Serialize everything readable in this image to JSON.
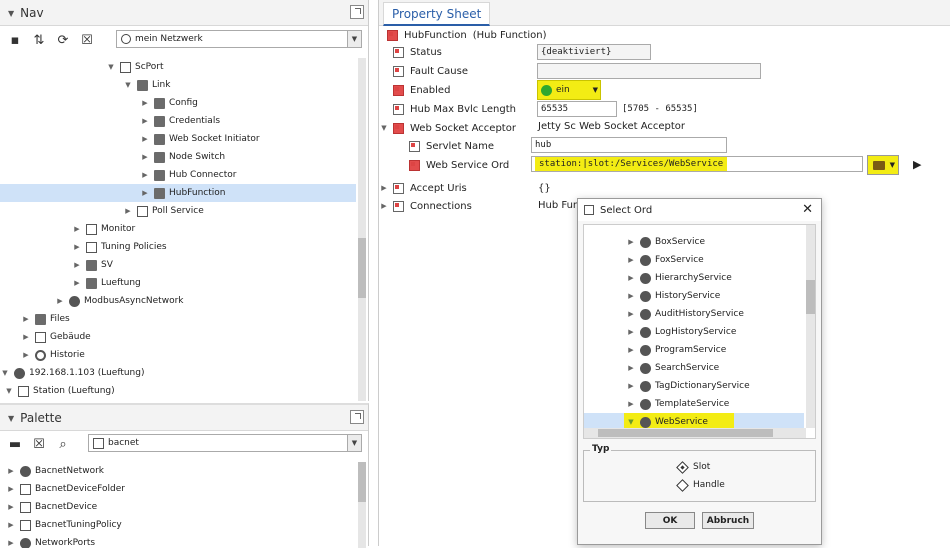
{
  "nav": {
    "title": "Nav",
    "ord_combo": "mein Netzwerk",
    "tree": [
      {
        "label": "ScPort",
        "icon": "port-icon",
        "depth": 8,
        "expanded": true
      },
      {
        "label": "Link",
        "icon": "folder-icon",
        "depth": 9,
        "expanded": true
      },
      {
        "label": "Config",
        "icon": "folder-icon",
        "depth": 10,
        "expanded": false
      },
      {
        "label": "Credentials",
        "icon": "folder-icon",
        "depth": 10,
        "expanded": false
      },
      {
        "label": "Web Socket Initiator",
        "icon": "folder-icon",
        "depth": 10,
        "expanded": false
      },
      {
        "label": "Node Switch",
        "icon": "folder-icon",
        "depth": 10,
        "expanded": false
      },
      {
        "label": "Hub Connector",
        "icon": "folder-icon",
        "depth": 10,
        "expanded": false
      },
      {
        "label": "HubFunction",
        "icon": "folder-icon",
        "depth": 10,
        "expanded": false,
        "selected": true
      },
      {
        "label": "Poll Service",
        "icon": "poll-icon",
        "depth": 9,
        "expanded": false
      },
      {
        "label": "Monitor",
        "icon": "monitor-icon",
        "depth": 6,
        "expanded": false
      },
      {
        "label": "Tuning Policies",
        "icon": "tuning-icon",
        "depth": 6,
        "expanded": false
      },
      {
        "label": "SV",
        "icon": "folder-icon",
        "depth": 6,
        "expanded": false
      },
      {
        "label": "Lueftung",
        "icon": "folder-icon",
        "depth": 6,
        "expanded": false
      },
      {
        "label": "ModbusAsyncNetwork",
        "icon": "network-icon",
        "depth": 5,
        "expanded": false
      },
      {
        "label": "Files",
        "icon": "folder-icon",
        "depth": 3,
        "expanded": false
      },
      {
        "label": "Gebäude",
        "icon": "building-icon",
        "depth": 3,
        "expanded": false
      },
      {
        "label": "Historie",
        "icon": "history-icon",
        "depth": 3,
        "expanded": false
      },
      {
        "label": "192.168.1.103 (Lueftung)",
        "icon": "host-icon",
        "depth": 1,
        "expanded": true
      },
      {
        "label": "Station (Lueftung)",
        "icon": "station-icon",
        "depth": 2,
        "expanded": true
      }
    ]
  },
  "palette": {
    "title": "Palette",
    "combo": "bacnet",
    "items": [
      {
        "label": "BacnetNetwork",
        "icon": "network-icon"
      },
      {
        "label": "BacnetDeviceFolder",
        "icon": "folder-icon"
      },
      {
        "label": "BacnetDevice",
        "icon": "device-icon"
      },
      {
        "label": "BacnetTuningPolicy",
        "icon": "tuning-icon"
      },
      {
        "label": "NetworkPorts",
        "icon": "network-icon"
      }
    ]
  },
  "property_sheet": {
    "tab": "Property Sheet",
    "header_name": "HubFunction",
    "header_type": "(Hub Function)",
    "rows": [
      {
        "label": "Status",
        "value": "{deaktiviert}"
      },
      {
        "label": "Fault Cause",
        "value": ""
      },
      {
        "label": "Enabled",
        "value": "ein"
      },
      {
        "label": "Hub Max Bvlc Length",
        "value": "65535",
        "range": "[5705 - 65535]"
      },
      {
        "label": "Web Socket Acceptor",
        "value": "Jetty Sc Web Socket Acceptor"
      },
      {
        "label": "Servlet Name",
        "value": "hub"
      },
      {
        "label": "Web Service Ord",
        "value": "station:|slot:/Services/WebService"
      },
      {
        "label": "Accept Uris",
        "value": "{}"
      },
      {
        "label": "Connections",
        "value": "Hub Fun"
      }
    ]
  },
  "dialog": {
    "title": "Select Ord",
    "services": [
      "BoxService",
      "FoxService",
      "HierarchyService",
      "HistoryService",
      "AuditHistoryService",
      "LogHistoryService",
      "ProgramService",
      "SearchService",
      "TagDictionaryService",
      "TemplateService",
      "WebService"
    ],
    "selected": "WebService",
    "type_legend": "Typ",
    "type_options": [
      {
        "label": "Slot",
        "selected": true
      },
      {
        "label": "Handle",
        "selected": false
      }
    ],
    "ok": "OK",
    "cancel": "Abbruch"
  },
  "colors": {
    "highlight": "#f3ec14",
    "selection": "#cfe2f8",
    "tab_blue": "#2a5ea8",
    "enabled_green": "#2fa82f"
  }
}
